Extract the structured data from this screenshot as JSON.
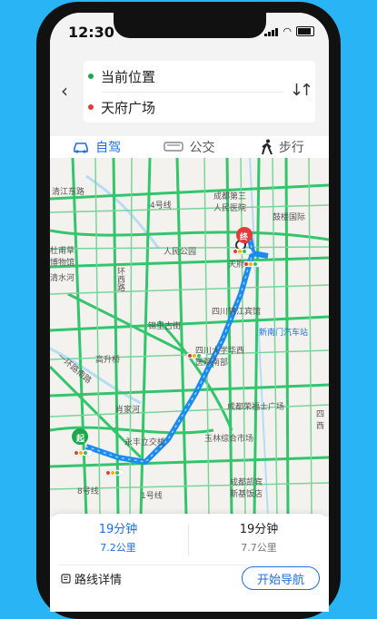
{
  "status": {
    "time": "12:30"
  },
  "route": {
    "origin": "当前位置",
    "destination": "天府广场"
  },
  "modes": [
    {
      "label": "自驾",
      "icon": "car-icon"
    },
    {
      "label": "公交",
      "icon": "bus-icon"
    },
    {
      "label": "步行",
      "icon": "walk-icon"
    }
  ],
  "map": {
    "labels": {
      "qingjiang": "清江东路",
      "chengdu_hospital": "成都第三\n人民医院",
      "guyin": "鼓楼国际",
      "du_fu": "杜甫草\n博物馆",
      "qingshui": "清水河",
      "renmin_park": "人民公园",
      "tianfu": "天府",
      "start_marker": "起",
      "end_marker": "终",
      "sichuan_hotel": "四川锦江宾馆",
      "xinnanmen": "新南门汽车站",
      "jinli": "锦里古街",
      "huanxi": "环西路",
      "shengsheng": "高升桥",
      "sichuan_hosp": "四川大学华西\n医院南部",
      "xiaojiahe": "肖家河",
      "yongfeng": "永丰立交桥",
      "yulin": "玉林综合市场",
      "chengdu_plaza": "成都荣福士广场",
      "kaibin": "成都凯宾\n斯基饭店",
      "yihuan": "一环路南路",
      "road_4": "4号线",
      "road_1": "1号线",
      "road_8": "8号线",
      "west_road": "四\n西"
    }
  },
  "options": [
    {
      "time": "19分钟",
      "distance": "7.2公里",
      "selected": true
    },
    {
      "time": "19分钟",
      "distance": "7.7公里",
      "selected": false
    }
  ],
  "actions": {
    "details": "路线详情",
    "navigate": "开始导航"
  },
  "colors": {
    "accent": "#1d6fe0",
    "route": "#1b8bf0",
    "road": "#32c56b",
    "origin": "#1ea84b",
    "destination": "#e33a3a"
  }
}
